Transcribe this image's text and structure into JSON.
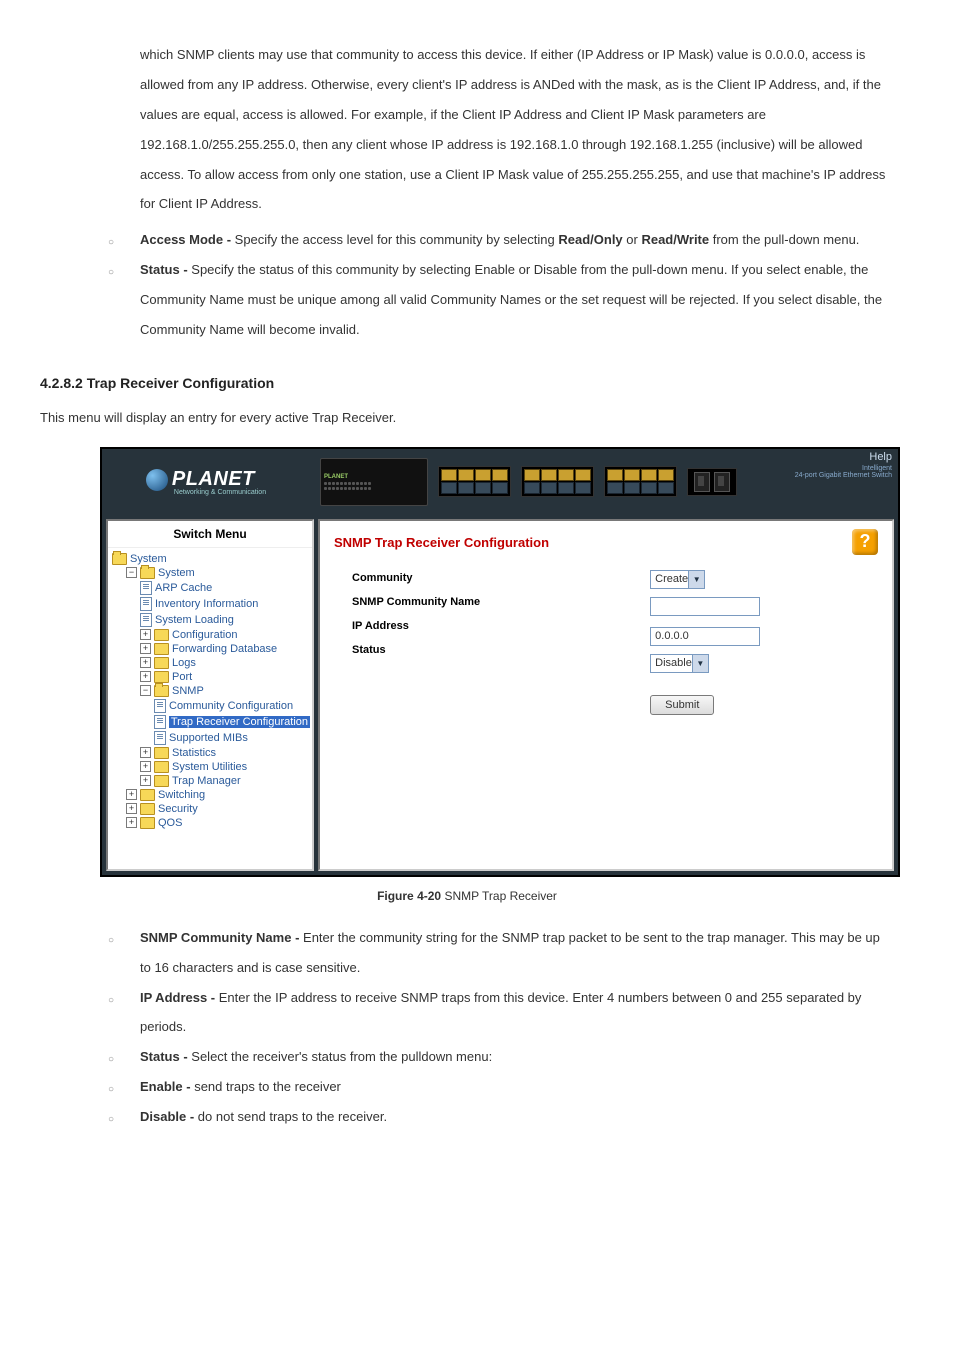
{
  "topPara": "which SNMP clients may use that community to access this device. If either (IP Address or IP Mask) value is 0.0.0.0, access is allowed from any IP address. Otherwise, every client's IP address is ANDed with the mask, as is the Client IP Address, and, if the values are equal, access is allowed. For example, if the Client IP Address and Client IP Mask parameters are 192.168.1.0/255.255.255.0, then any client whose IP address is 192.168.1.0 through 192.168.1.255 (inclusive) will be allowed access. To allow access from only one station, use a Client IP Mask value of 255.255.255.255, and use that machine's IP address for Client IP Address.",
  "bullets1": {
    "b1_label": "Access Mode -",
    "b1_a": " Specify the access level for this community by selecting ",
    "b1_ro": "Read/Only",
    "b1_or": " or ",
    "b1_rw": "Read/Write",
    "b1_b": " from the pull-down menu.",
    "b2_label": "Status -",
    "b2": " Specify the status of this community by selecting Enable or Disable from the pull-down menu. If you select enable, the Community Name must be unique among all valid Community Names or the set request will be rejected. If you select disable, the Community Name will become invalid."
  },
  "section": {
    "heading": "4.2.8.2 Trap Receiver Configuration",
    "intro": "This menu will display an entry for every active Trap Receiver."
  },
  "shot": {
    "logo": "PLANET",
    "logoSub": "Networking & Communication",
    "help": "Help",
    "helpSub1": "Intelligent",
    "helpSub2": "24-port Gigabit Ethernet Switch",
    "treeTitle": "Switch Menu",
    "tree": {
      "root": "System",
      "systemFolder": "System",
      "arp": "ARP Cache",
      "inv": "Inventory Information",
      "load": "System Loading",
      "conf": "Configuration",
      "fdb": "Forwarding Database",
      "logs": "Logs",
      "port": "Port",
      "snmp": "SNMP",
      "comm": "Community Configuration",
      "trap": "Trap Receiver Configuration",
      "mibs": "Supported MIBs",
      "stats": "Statistics",
      "sysutil": "System Utilities",
      "trapmgr": "Trap Manager",
      "switching": "Switching",
      "security": "Security",
      "qos": "QOS"
    },
    "contentTitle": "SNMP Trap Receiver Configuration",
    "labels": {
      "community": "Community",
      "commName": "SNMP Community Name",
      "ip": "IP Address",
      "status": "Status"
    },
    "fields": {
      "communitySel": "Create",
      "commNameVal": "",
      "ipVal": "0.0.0.0",
      "statusSel": "Disable"
    },
    "submit": "Submit"
  },
  "figureLabel": "SNMP Trap Receiver",
  "figurePrefix": "Figure 4-20",
  "bullets2": {
    "b1_label": "SNMP Community Name -",
    "b1": " Enter the community string for the SNMP trap packet to be sent to the trap manager. This may be up to 16 characters and is case sensitive.",
    "b2_label": "IP Address -",
    "b2": " Enter the IP address to receive SNMP traps from this device. Enter 4 numbers between 0 and 255 separated by periods.",
    "b3_label": "Status -",
    "b3": " Select the receiver's status from the pulldown menu:",
    "b4_label": "Enable -",
    "b4": " send traps to the receiver",
    "b5_label": "Disable -",
    "b5": " do not send traps to the receiver."
  }
}
